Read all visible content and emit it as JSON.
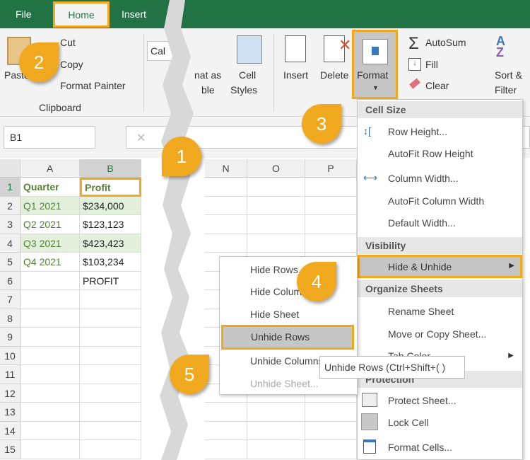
{
  "tabs": [
    "File",
    "Home",
    "Insert"
  ],
  "ribbon": {
    "paste": "Paste",
    "cut": "Cut",
    "copy": "Copy",
    "format_painter": "Format Painter",
    "clipboard": "Clipboard",
    "font_box": "Cal",
    "format_as_table": [
      "nat as",
      "ble"
    ],
    "cell_styles": [
      "Cell",
      "Styles"
    ],
    "insert": "Insert",
    "delete": "Delete",
    "format": "Format",
    "autosum": "AutoSum",
    "fill": "Fill",
    "clear": "Clear",
    "sort_filter": [
      "Sort &",
      "Filter"
    ]
  },
  "formula_bar": {
    "name_box": "B1",
    "cancel": "✕"
  },
  "grid": {
    "columns": [
      "A",
      "B",
      "N",
      "O",
      "P"
    ],
    "rows": [
      "1",
      "2",
      "3",
      "4",
      "5",
      "6",
      "7",
      "8",
      "9",
      "10",
      "11",
      "12",
      "13",
      "14",
      "15"
    ],
    "cells": [
      [
        "Quarter",
        "Profit"
      ],
      [
        "Q1 2021",
        "$234,000"
      ],
      [
        "Q2 2021",
        "$123,123"
      ],
      [
        "Q3 2021",
        "$423,423"
      ],
      [
        "Q4 2021",
        "$103,234"
      ],
      [
        "",
        "PROFIT"
      ]
    ]
  },
  "format_menu": {
    "cell_size": "Cell Size",
    "row_height": "Row Height...",
    "autofit_row": "AutoFit Row Height",
    "column_width": "Column Width...",
    "autofit_col": "AutoFit Column Width",
    "default_width": "Default Width...",
    "visibility": "Visibility",
    "hide_unhide": "Hide & Unhide",
    "organize": "Organize Sheets",
    "rename": "Rename Sheet",
    "move_copy": "Move or Copy Sheet...",
    "tab_color": "Tab Color",
    "protection": "Protection",
    "protect_sheet": "Protect Sheet...",
    "lock_cell": "Lock Cell",
    "format_cells": "Format Cells..."
  },
  "submenu": {
    "hide_rows": "Hide Rows",
    "hide_columns": "Hide Columns",
    "hide_sheet": "Hide Sheet",
    "unhide_rows": "Unhide Rows",
    "unhide_columns": "Unhide Columns",
    "unhide_sheet": "Unhide Sheet..."
  },
  "tooltip": "Unhide Rows (Ctrl+Shift+( )",
  "callouts": [
    "1",
    "2",
    "3",
    "4",
    "5"
  ],
  "colors": {
    "excel_green": "#217346",
    "highlight": "#f0a81e",
    "data_green": "#548235",
    "row_band": "#e2efda"
  }
}
